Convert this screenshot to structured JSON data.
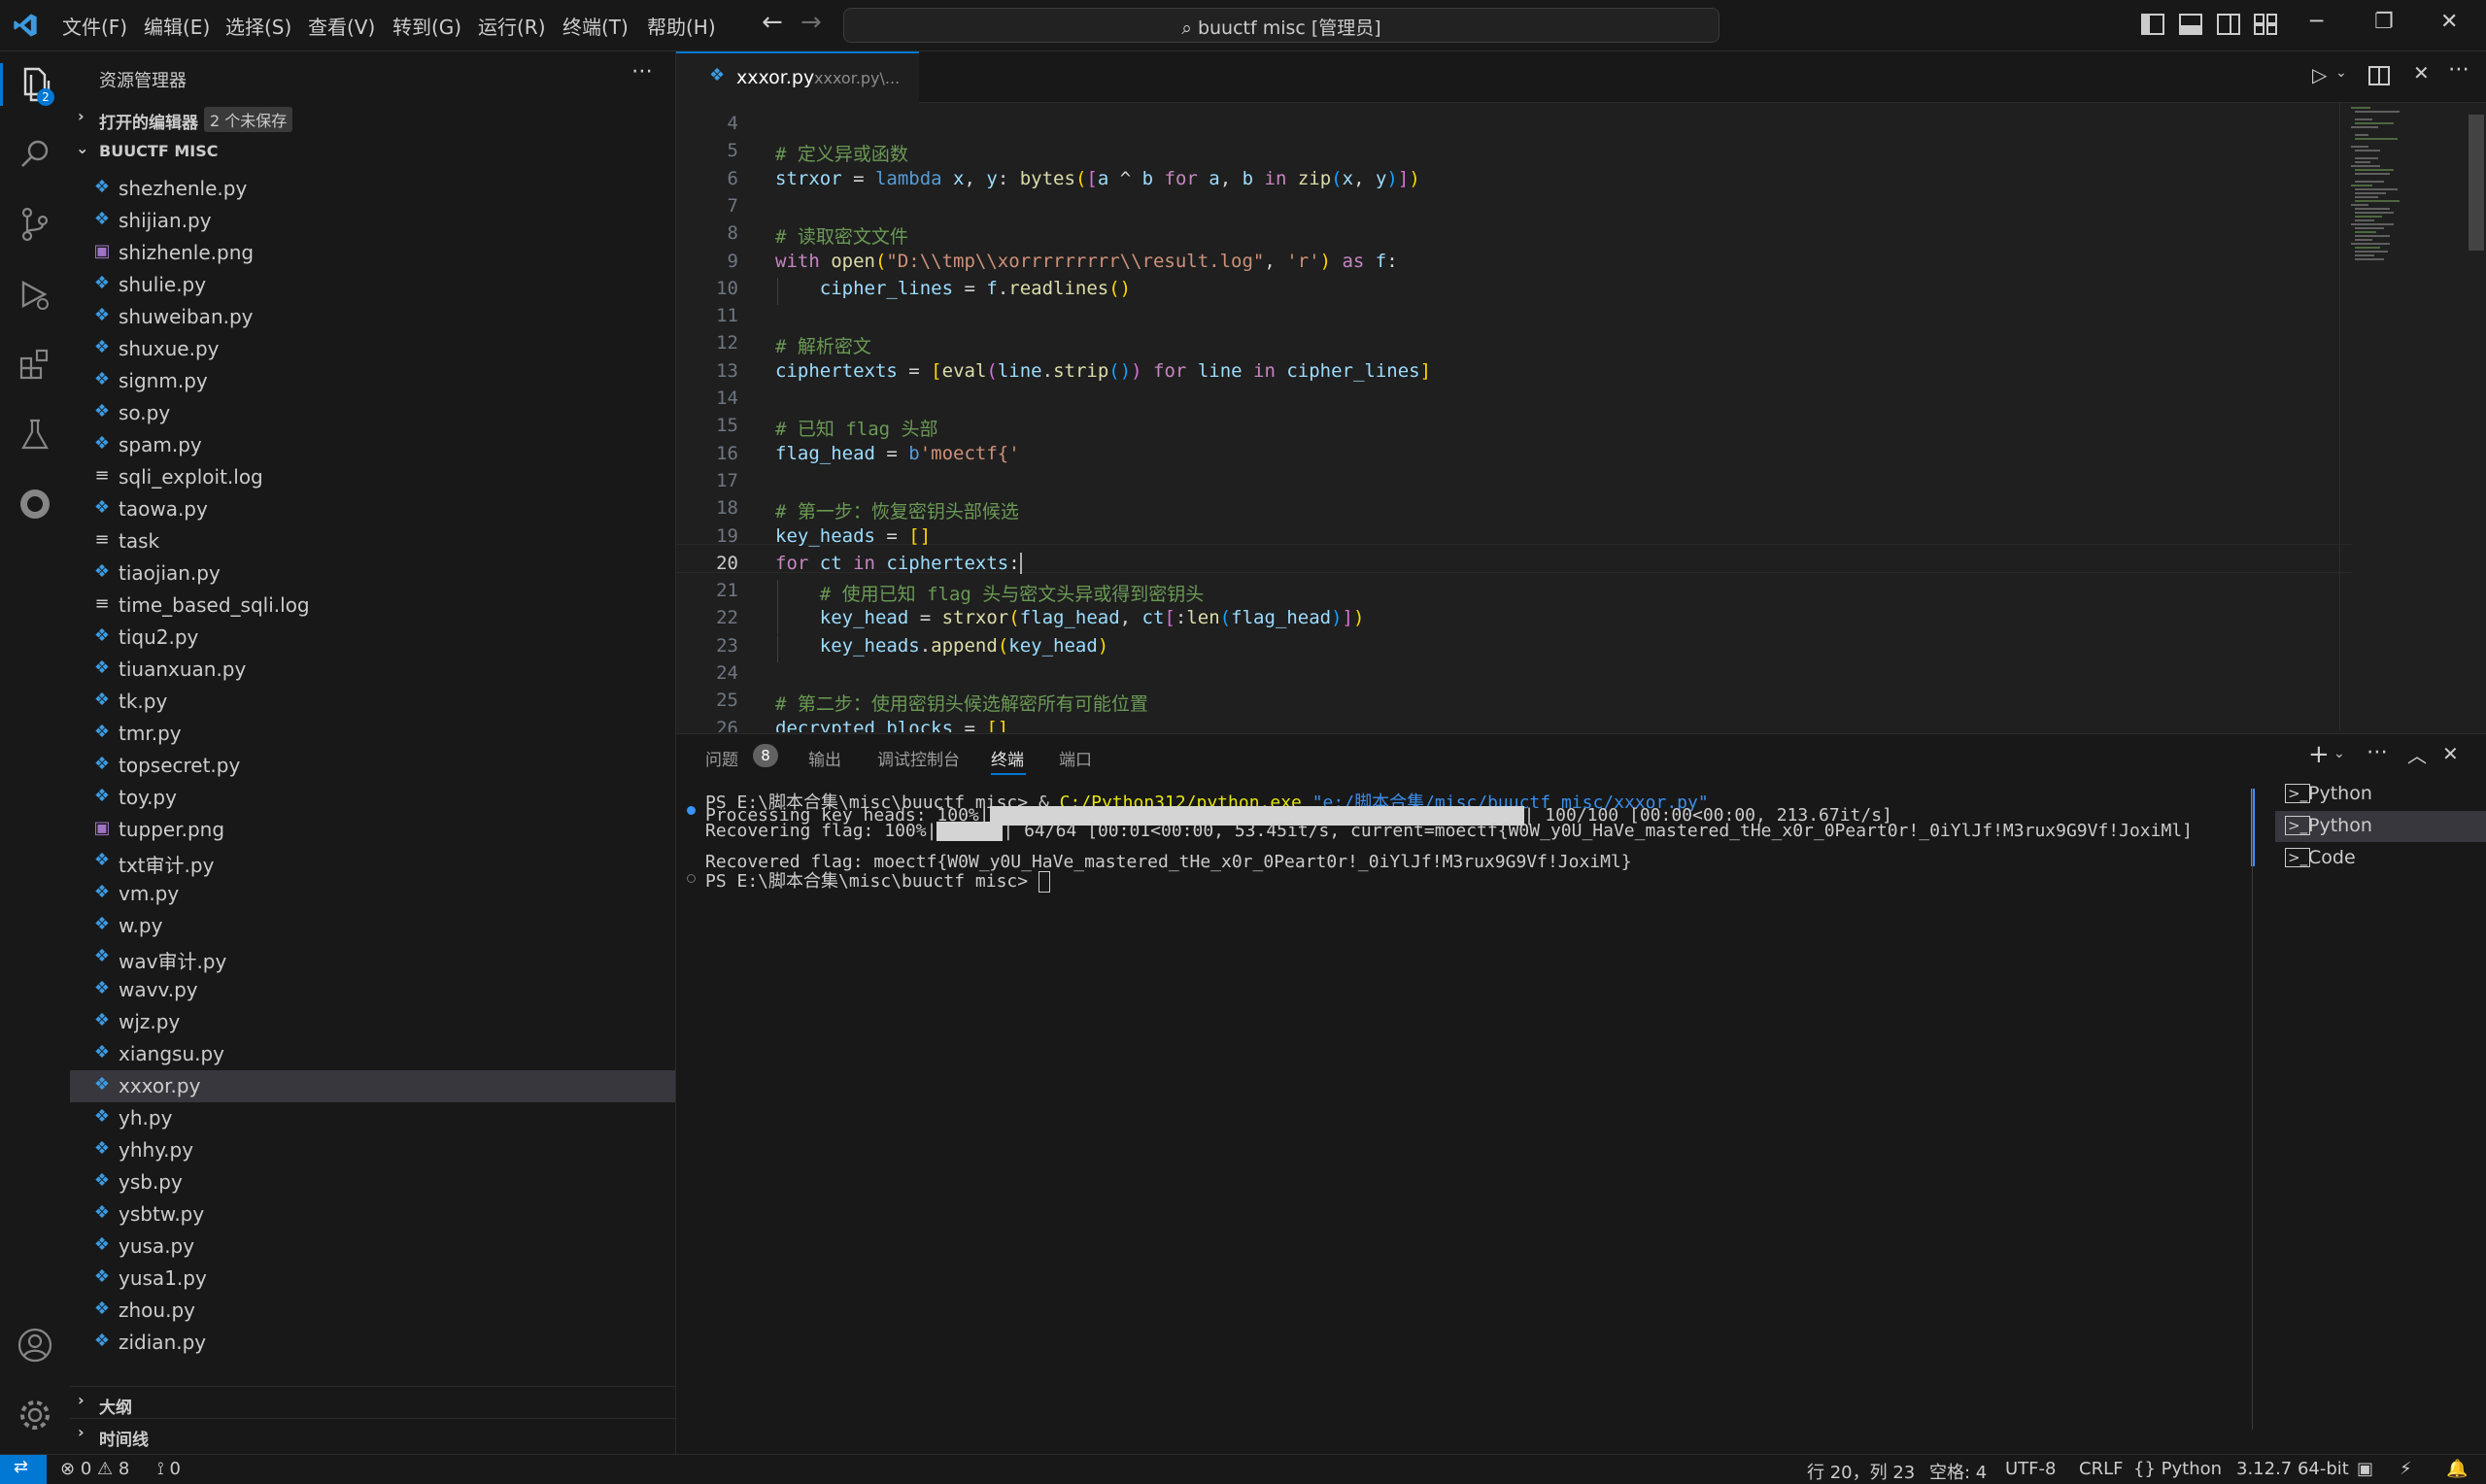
{
  "titlebar": {
    "menu": [
      "文件(F)",
      "编辑(E)",
      "选择(S)",
      "查看(V)",
      "转到(G)",
      "运行(R)",
      "终端(T)",
      "帮助(H)"
    ],
    "command_center": "buuctf misc [管理员]"
  },
  "activitybar": {
    "explorer_badge": "2"
  },
  "sidebar": {
    "title": "资源管理器",
    "open_editors": {
      "label": "打开的编辑器",
      "badge": "2 个未保存"
    },
    "folder": "BUUCTF MISC",
    "files": [
      {
        "name": "shezhenle.py",
        "type": "py"
      },
      {
        "name": "shijian.py",
        "type": "py"
      },
      {
        "name": "shizhenle.png",
        "type": "png"
      },
      {
        "name": "shulie.py",
        "type": "py"
      },
      {
        "name": "shuweiban.py",
        "type": "py"
      },
      {
        "name": "shuxue.py",
        "type": "py"
      },
      {
        "name": "signm.py",
        "type": "py"
      },
      {
        "name": "so.py",
        "type": "py"
      },
      {
        "name": "spam.py",
        "type": "py"
      },
      {
        "name": "sqli_exploit.log",
        "type": "txt"
      },
      {
        "name": "taowa.py",
        "type": "py"
      },
      {
        "name": "task",
        "type": "txt"
      },
      {
        "name": "tiaojian.py",
        "type": "py"
      },
      {
        "name": "time_based_sqli.log",
        "type": "txt"
      },
      {
        "name": "tiqu2.py",
        "type": "py"
      },
      {
        "name": "tiuanxuan.py",
        "type": "py"
      },
      {
        "name": "tk.py",
        "type": "py"
      },
      {
        "name": "tmr.py",
        "type": "py"
      },
      {
        "name": "topsecret.py",
        "type": "py"
      },
      {
        "name": "toy.py",
        "type": "py"
      },
      {
        "name": "tupper.png",
        "type": "png"
      },
      {
        "name": "txt审计.py",
        "type": "py"
      },
      {
        "name": "vm.py",
        "type": "py"
      },
      {
        "name": "w.py",
        "type": "py"
      },
      {
        "name": "wav审计.py",
        "type": "py"
      },
      {
        "name": "wavv.py",
        "type": "py"
      },
      {
        "name": "wjz.py",
        "type": "py"
      },
      {
        "name": "xiangsu.py",
        "type": "py"
      },
      {
        "name": "xxxor.py",
        "type": "py",
        "selected": true
      },
      {
        "name": "yh.py",
        "type": "py"
      },
      {
        "name": "yhhy.py",
        "type": "py"
      },
      {
        "name": "ysb.py",
        "type": "py"
      },
      {
        "name": "ysbtw.py",
        "type": "py"
      },
      {
        "name": "yusa.py",
        "type": "py"
      },
      {
        "name": "yusa1.py",
        "type": "py"
      },
      {
        "name": "zhou.py",
        "type": "py"
      },
      {
        "name": "zidian.py",
        "type": "py"
      }
    ],
    "outline": "大纲",
    "timeline": "时间线"
  },
  "editor": {
    "tab_label": "xxxor.py",
    "tab_path": "xxxor.py\\...",
    "current_line": "20",
    "lines": [
      {
        "n": "4",
        "t": []
      },
      {
        "n": "5",
        "t": [
          [
            "cm",
            "# 定义异或函数"
          ]
        ]
      },
      {
        "n": "6",
        "t": [
          [
            "va",
            "strxor"
          ],
          [
            "op",
            " = "
          ],
          [
            "kwb",
            "lambda"
          ],
          [
            "va",
            " x"
          ],
          [
            "op",
            ", "
          ],
          [
            "va",
            "y"
          ],
          [
            "op",
            ": "
          ],
          [
            "fn",
            "bytes"
          ],
          [
            "pa1",
            "("
          ],
          [
            "pa2",
            "["
          ],
          [
            "va",
            "a"
          ],
          [
            "op",
            " ^ "
          ],
          [
            "va",
            "b"
          ],
          [
            "kw",
            " for "
          ],
          [
            "va",
            "a"
          ],
          [
            "op",
            ", "
          ],
          [
            "va",
            "b"
          ],
          [
            "kw",
            " in "
          ],
          [
            "fn",
            "zip"
          ],
          [
            "pa3",
            "("
          ],
          [
            "va",
            "x"
          ],
          [
            "op",
            ", "
          ],
          [
            "va",
            "y"
          ],
          [
            "pa3",
            ")"
          ],
          [
            "pa2",
            "]"
          ],
          [
            "pa1",
            ")"
          ]
        ]
      },
      {
        "n": "7",
        "t": []
      },
      {
        "n": "8",
        "t": [
          [
            "cm",
            "# 读取密文文件"
          ]
        ]
      },
      {
        "n": "9",
        "t": [
          [
            "kw",
            "with "
          ],
          [
            "fn",
            "open"
          ],
          [
            "pa1",
            "("
          ],
          [
            "st",
            "\"D:\\\\tmp\\\\xorrrrrrrrr\\\\result.log\""
          ],
          [
            "op",
            ", "
          ],
          [
            "st",
            "'r'"
          ],
          [
            "pa1",
            ")"
          ],
          [
            "kw",
            " as "
          ],
          [
            "va",
            "f"
          ],
          [
            "op",
            ":"
          ]
        ]
      },
      {
        "n": "10",
        "t": [
          [
            "op",
            "    "
          ],
          [
            "va",
            "cipher_lines"
          ],
          [
            "op",
            " = "
          ],
          [
            "va",
            "f"
          ],
          [
            "op",
            "."
          ],
          [
            "fn",
            "readlines"
          ],
          [
            "pa1",
            "()"
          ]
        ]
      },
      {
        "n": "11",
        "t": []
      },
      {
        "n": "12",
        "t": [
          [
            "cm",
            "# 解析密文"
          ]
        ]
      },
      {
        "n": "13",
        "t": [
          [
            "va",
            "ciphertexts"
          ],
          [
            "op",
            " = "
          ],
          [
            "pa1",
            "["
          ],
          [
            "fn",
            "eval"
          ],
          [
            "pa2",
            "("
          ],
          [
            "va",
            "line"
          ],
          [
            "op",
            "."
          ],
          [
            "fn",
            "strip"
          ],
          [
            "pa3",
            "()"
          ],
          [
            "pa2",
            ")"
          ],
          [
            "kw",
            " for "
          ],
          [
            "va",
            "line"
          ],
          [
            "kw",
            " in "
          ],
          [
            "va",
            "cipher_lines"
          ],
          [
            "pa1",
            "]"
          ]
        ]
      },
      {
        "n": "14",
        "t": []
      },
      {
        "n": "15",
        "t": [
          [
            "cm",
            "# 已知 flag 头部"
          ]
        ]
      },
      {
        "n": "16",
        "t": [
          [
            "va",
            "flag_head"
          ],
          [
            "op",
            " = "
          ],
          [
            "kwb",
            "b"
          ],
          [
            "st",
            "'moectf{'"
          ]
        ]
      },
      {
        "n": "17",
        "t": []
      },
      {
        "n": "18",
        "t": [
          [
            "cm",
            "# 第一步：恢复密钥头部候选"
          ]
        ]
      },
      {
        "n": "19",
        "t": [
          [
            "va",
            "key_heads"
          ],
          [
            "op",
            " = "
          ],
          [
            "pa1",
            "[]"
          ]
        ]
      },
      {
        "n": "20",
        "t": [
          [
            "kw",
            "for "
          ],
          [
            "va",
            "ct"
          ],
          [
            "kw",
            " in "
          ],
          [
            "va",
            "ciphertexts"
          ],
          [
            "op",
            ":"
          ]
        ]
      },
      {
        "n": "21",
        "t": [
          [
            "op",
            "    "
          ],
          [
            "cm",
            "# 使用已知 flag 头与密文头异或得到密钥头"
          ]
        ]
      },
      {
        "n": "22",
        "t": [
          [
            "op",
            "    "
          ],
          [
            "va",
            "key_head"
          ],
          [
            "op",
            " = "
          ],
          [
            "fn",
            "strxor"
          ],
          [
            "pa1",
            "("
          ],
          [
            "va",
            "flag_head"
          ],
          [
            "op",
            ", "
          ],
          [
            "va",
            "ct"
          ],
          [
            "pa2",
            "["
          ],
          [
            "op",
            ":"
          ],
          [
            "fn",
            "len"
          ],
          [
            "pa3",
            "("
          ],
          [
            "va",
            "flag_head"
          ],
          [
            "pa3",
            ")"
          ],
          [
            "pa2",
            "]"
          ],
          [
            "pa1",
            ")"
          ]
        ]
      },
      {
        "n": "23",
        "t": [
          [
            "op",
            "    "
          ],
          [
            "va",
            "key_heads"
          ],
          [
            "op",
            "."
          ],
          [
            "fn",
            "append"
          ],
          [
            "pa1",
            "("
          ],
          [
            "va",
            "key_head"
          ],
          [
            "pa1",
            ")"
          ]
        ]
      },
      {
        "n": "24",
        "t": []
      },
      {
        "n": "25",
        "t": [
          [
            "cm",
            "# 第二步：使用密钥头候选解密所有可能位置"
          ]
        ]
      },
      {
        "n": "26",
        "t": [
          [
            "va",
            "decrypted_blocks"
          ],
          [
            "op",
            " = "
          ],
          [
            "pa1",
            "[]"
          ]
        ]
      }
    ]
  },
  "panel": {
    "tabs": [
      "问题",
      "输出",
      "调试控制台",
      "终端",
      "端口"
    ],
    "problems_count": "8",
    "active_tab": "终端",
    "terminal": {
      "prompt1": "PS E:\\脚本合集\\misc\\buuctf misc> ",
      "cmd_amp": "& ",
      "cmd_exe": "C:/Python312/python.exe ",
      "cmd_arg": "\"e:/脚本合集/misc/buuctf misc/xxxor.py\"",
      "progress1_label": "Processing key heads: 100%|",
      "progress1_tail": "| 100/100 [00:00<00:00, 213.67it/s]",
      "progress1_fraction": 1.0,
      "progress2_label": "Recovering flag: 100%|",
      "progress2_tail": "| 64/64 [00:01<00:00, 53.45it/s, current=moectf{W0W_y0U_HaVe_mastered_tHe_x0r_0Peart0r!_0iYlJf!M3rux9G9Vf!JoxiMl]",
      "progress2_fraction": 1.0,
      "result": "Recovered flag: moectf{W0W_y0U_HaVe_mastered_tHe_x0r_0Peart0r!_0iYlJf!M3rux9G9Vf!JoxiMl}",
      "prompt2": "PS E:\\脚本合集\\misc\\buuctf misc> "
    },
    "terminal_list": [
      "Python",
      "Python",
      "Code"
    ]
  },
  "statusbar": {
    "errors": "0",
    "warnings": "8",
    "ports": "0",
    "position": "行 20，列 23",
    "spaces": "空格: 4",
    "encoding": "UTF-8",
    "eol": "CRLF",
    "language": "{} Python",
    "interpreter": "3.12.7 64-bit"
  },
  "colors": {
    "accent": "#0078d4",
    "remote": "#0078d4"
  }
}
